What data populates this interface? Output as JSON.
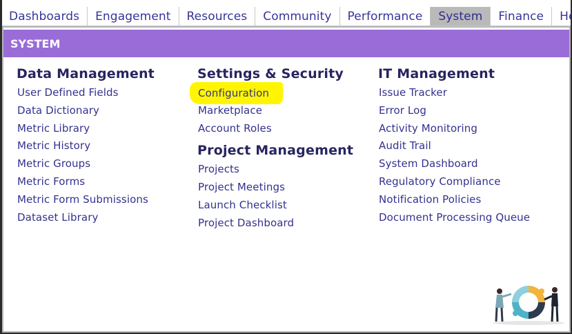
{
  "nav": {
    "tabs": [
      {
        "label": "Dashboards",
        "active": false
      },
      {
        "label": "Engagement",
        "active": false
      },
      {
        "label": "Resources",
        "active": false
      },
      {
        "label": "Community",
        "active": false
      },
      {
        "label": "Performance",
        "active": false
      },
      {
        "label": "System",
        "active": true
      },
      {
        "label": "Finance",
        "active": false
      },
      {
        "label": "Help",
        "active": false
      }
    ]
  },
  "panel": {
    "title": "SYSTEM",
    "header_color": "#9a6cd7",
    "highlight_color": "#fff500",
    "columns": [
      {
        "heading": "Data Management",
        "items": [
          "User Defined Fields",
          "Data Dictionary",
          "Metric Library",
          "Metric History",
          "Metric Groups",
          "Metric Forms",
          "Metric Form Submissions",
          "Dataset Library"
        ]
      },
      {
        "heading": "Settings & Security",
        "items": [
          "Configuration",
          "Marketplace",
          "Account Roles"
        ],
        "highlighted_item": "Configuration"
      },
      {
        "heading": "Project Management",
        "items": [
          "Projects",
          "Project Meetings",
          "Launch Checklist",
          "Project Dashboard"
        ]
      },
      {
        "heading": "IT Management",
        "items": [
          "Issue Tracker",
          "Error Log",
          "Activity Monitoring",
          "Audit Trail",
          "System Dashboard",
          "Regulatory Compliance",
          "Notification Policies",
          "Document Processing Queue"
        ]
      }
    ],
    "illustration": "team-puzzle-cycle-illustration"
  }
}
